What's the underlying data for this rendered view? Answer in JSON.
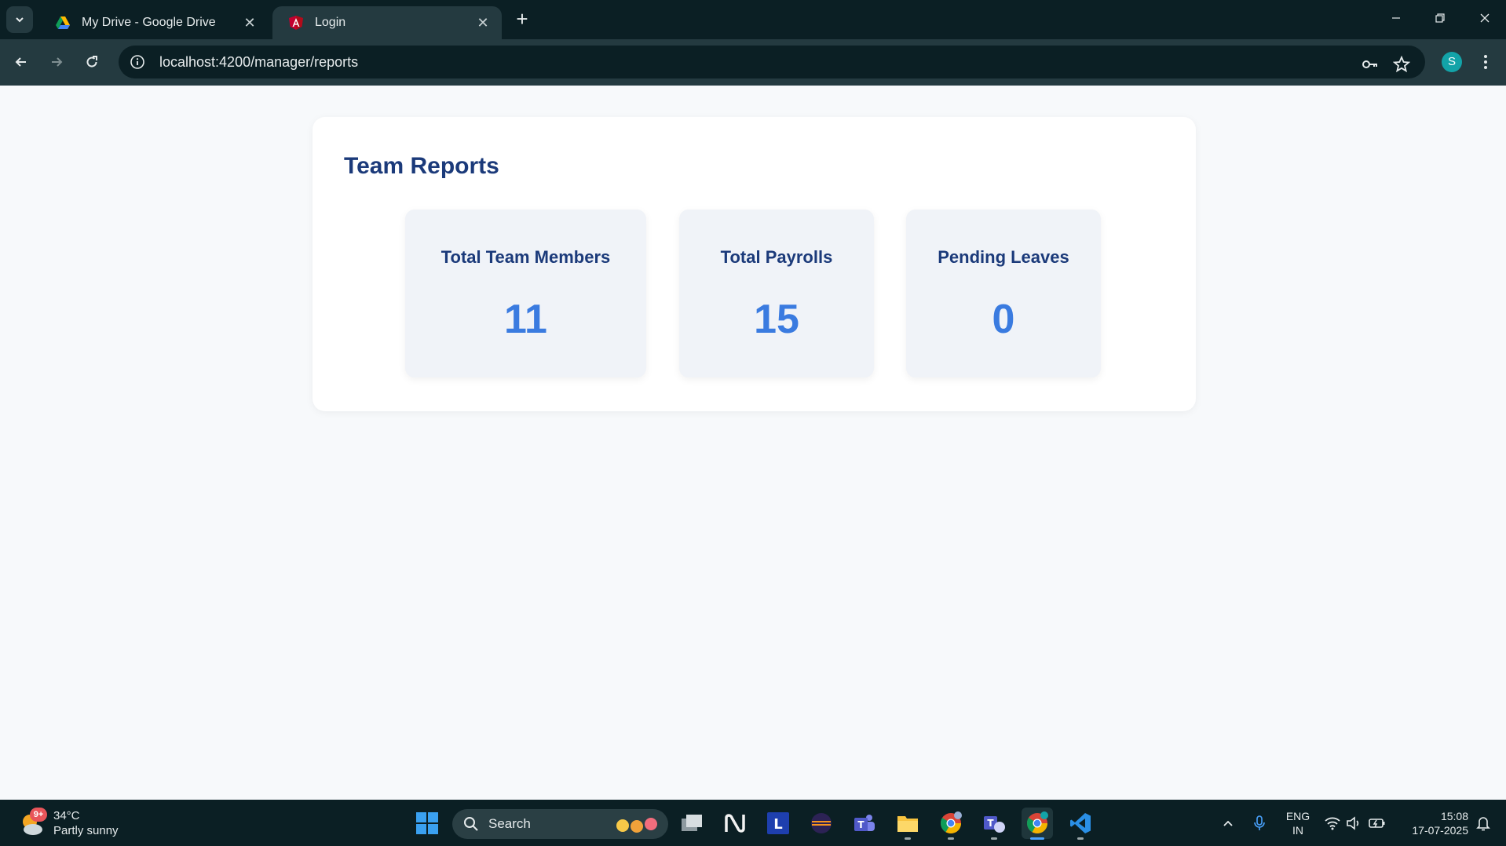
{
  "browser": {
    "tabs": [
      {
        "title": "My Drive - Google Drive",
        "favicon": "google-drive-icon",
        "active": false
      },
      {
        "title": "Login",
        "favicon": "angular-icon",
        "active": true
      }
    ],
    "url": "localhost:4200/manager/reports",
    "profile_initial": "S"
  },
  "page": {
    "title": "Team Reports",
    "stats": [
      {
        "label": "Total Team Members",
        "value": "11"
      },
      {
        "label": "Total Payrolls",
        "value": "15"
      },
      {
        "label": "Pending Leaves",
        "value": "0"
      }
    ]
  },
  "taskbar": {
    "weather": {
      "badge": "9+",
      "temp": "34°C",
      "condition": "Partly sunny"
    },
    "search_label": "Search",
    "language": {
      "line1": "ENG",
      "line2": "IN"
    },
    "clock": {
      "time": "15:08",
      "date": "17-07-2025"
    }
  },
  "colors": {
    "heading": "#1b3a7a",
    "stat_value": "#3a7be0",
    "chrome_dark": "#0b1f24",
    "chrome_mid": "#243a40",
    "profile": "#13a3a8"
  }
}
